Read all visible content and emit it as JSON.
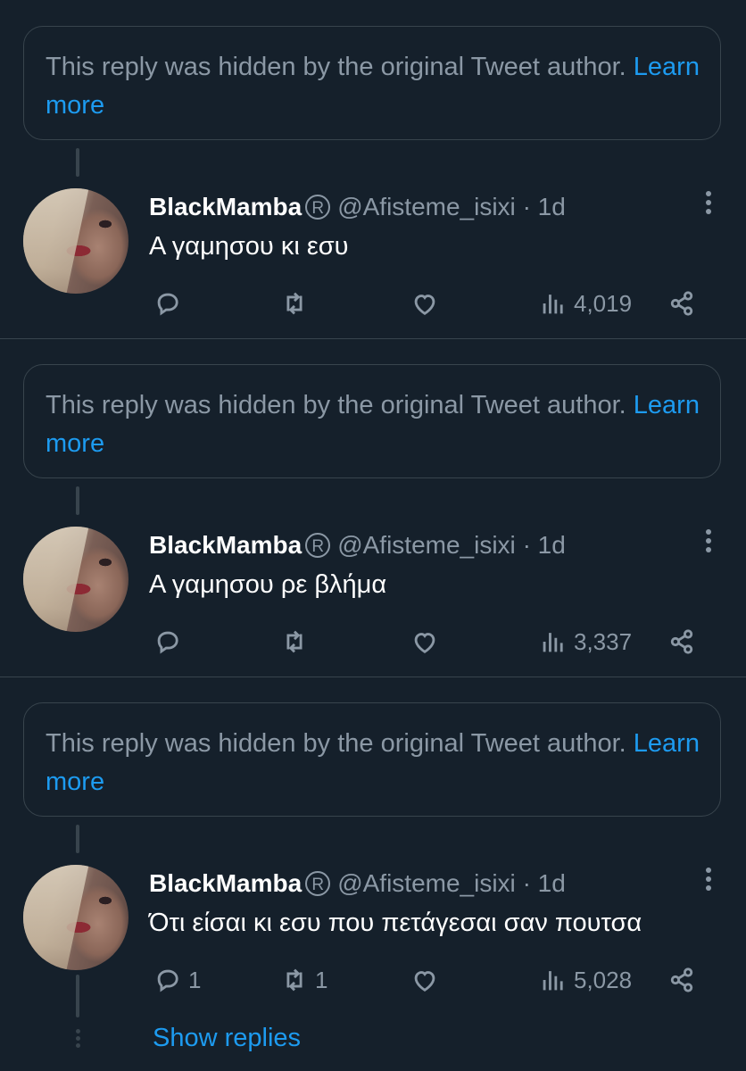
{
  "colors": {
    "background": "#15202b",
    "link": "#1d9bf0",
    "secondary_text": "#8b98a5",
    "border": "#38444d"
  },
  "hidden_notice": {
    "text": "This reply was hidden by the original Tweet author.",
    "link": "Learn more"
  },
  "tweets": [
    {
      "name": "BlackMamba",
      "badge": "R",
      "handle": "@Afisteme_isixi",
      "time": "· 1d",
      "text": "Α γαμησου κι εσυ",
      "replies": "",
      "retweets": "",
      "views": "4,019"
    },
    {
      "name": "BlackMamba",
      "badge": "R",
      "handle": "@Afisteme_isixi",
      "time": "· 1d",
      "text": "Α γαμησου ρε βλήμα",
      "replies": "",
      "retweets": "",
      "views": "3,337"
    },
    {
      "name": "BlackMamba",
      "badge": "R",
      "handle": "@Afisteme_isixi",
      "time": "· 1d",
      "text": "Ότι είσαι κι εσυ που πετάγεσαι σαν πουτσα",
      "replies": "1",
      "retweets": "1",
      "views": "5,028"
    }
  ],
  "icons": {
    "reply": "reply-icon",
    "retweet": "retweet-icon",
    "like": "heart-icon",
    "views": "views-icon",
    "share": "share-icon",
    "more": "more-vertical-icon"
  },
  "show_replies": "Show replies"
}
